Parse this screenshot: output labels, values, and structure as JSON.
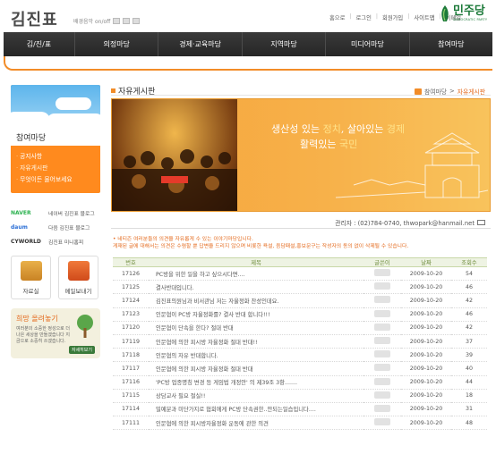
{
  "header": {
    "logo": "김진표",
    "bgm_label": "배경음악 on/off",
    "top_links": [
      "홈으로",
      "로그인",
      "회원가입",
      "사이트맵",
      "이메일"
    ],
    "party_name": "민주당",
    "party_sub": "DEMOCRATIC PARTY"
  },
  "nav": [
    "김/진/표",
    "의정마당",
    "경제·교육마당",
    "지역마당",
    "미디어마당",
    "참여마당"
  ],
  "sidebar": {
    "title": "참여마당",
    "items": [
      "공지사항",
      "자유게시판",
      "무엇이든 물어보세요"
    ],
    "blogs": [
      {
        "brand": "NAVER",
        "label": "네이버 김진표 블로그"
      },
      {
        "brand": "daum",
        "label": "다음 김진표 블로그"
      },
      {
        "brand": "CYWORLD",
        "label": "김진표 미니홈피"
      }
    ],
    "tiles": [
      "자료실",
      "메일보내기"
    ],
    "hope": {
      "title": "희망 올려놓기",
      "desc": "여러분의 소중한 정성으로 더나은 세상을 만들겠습니다 지금으로 소중히 쓰겠습니다.",
      "more": "자세히보기"
    }
  },
  "page": {
    "title": "자유게시판",
    "breadcrumb": [
      "참여마당",
      "자유게시판"
    ]
  },
  "banner": {
    "line1_a": "생산성 있는 ",
    "line1_b": "정치",
    "line1_c": ", 살아있는 ",
    "line1_d": "경제",
    "line2_a": "활력있는 ",
    "line2_b": "국민"
  },
  "admin": "관리자 : (02)784-0740, thwopark@hanmail.net",
  "notice": {
    "line1": "• 네티즌 여러분들의 의견을 자유롭게 수 있는 이야기마당입니다.",
    "line2": "게재된 글에 대해서는 의견은 수렴할 뿐 답변을 드리지 않으며 비롯한 욕설, 음담패설,홍보문구는 작성자의 동의 없이 삭제될 수 있습니다."
  },
  "table": {
    "headers": [
      "번호",
      "제목",
      "글쓴이",
      "날짜",
      "조회수"
    ],
    "rows": [
      {
        "no": "17126",
        "subject": "PC방을 위한 일을 하고 싶으시다면....",
        "date": "2009-10-20",
        "hits": "54"
      },
      {
        "no": "17125",
        "subject": "결사반대입니다.",
        "date": "2009-10-20",
        "hits": "46"
      },
      {
        "no": "17124",
        "subject": "김진표의원님과 비서관님 저는 자율정화 찬성인데요.",
        "date": "2009-10-20",
        "hits": "42"
      },
      {
        "no": "17123",
        "subject": "인문협이 PC방 자율정화를? 결사 반대 합니다!!!",
        "date": "2009-10-20",
        "hits": "46"
      },
      {
        "no": "17120",
        "subject": "인문협이 단속을 한다? 절대 반대",
        "date": "2009-10-20",
        "hits": "42"
      },
      {
        "no": "17119",
        "subject": "인문협에 의한 피시방 자율정화 절대 반대!!",
        "date": "2009-10-20",
        "hits": "37"
      },
      {
        "no": "17118",
        "subject": "인문협의 자유 반대합니다.",
        "date": "2009-10-20",
        "hits": "39"
      },
      {
        "no": "17117",
        "subject": "인문협에 의한 피시방 자율정화 절대 반대",
        "date": "2009-10-20",
        "hits": "40"
      },
      {
        "no": "17116",
        "subject": "'PC방 업종명칭 변경 등 게임법 개정안' 의 제39조 3항.......",
        "date": "2009-10-20",
        "hits": "44"
      },
      {
        "no": "17115",
        "subject": "상담교사 필요 절실!!",
        "date": "2009-10-20",
        "hits": "18"
      },
      {
        "no": "17114",
        "subject": "밀예분과 미단가지로 협회에게 PC방 단속권한..안되는일습입니다....",
        "date": "2009-10-20",
        "hits": "31"
      },
      {
        "no": "17111",
        "subject": "인문협에 의한 피시방자율정화 운동에 관한 의견",
        "date": "2009-10-20",
        "hits": "48"
      }
    ]
  },
  "colors": {
    "accent": "#f28c28",
    "nav_bg": "#2c2c2c",
    "party_green": "#1d7a3a"
  }
}
